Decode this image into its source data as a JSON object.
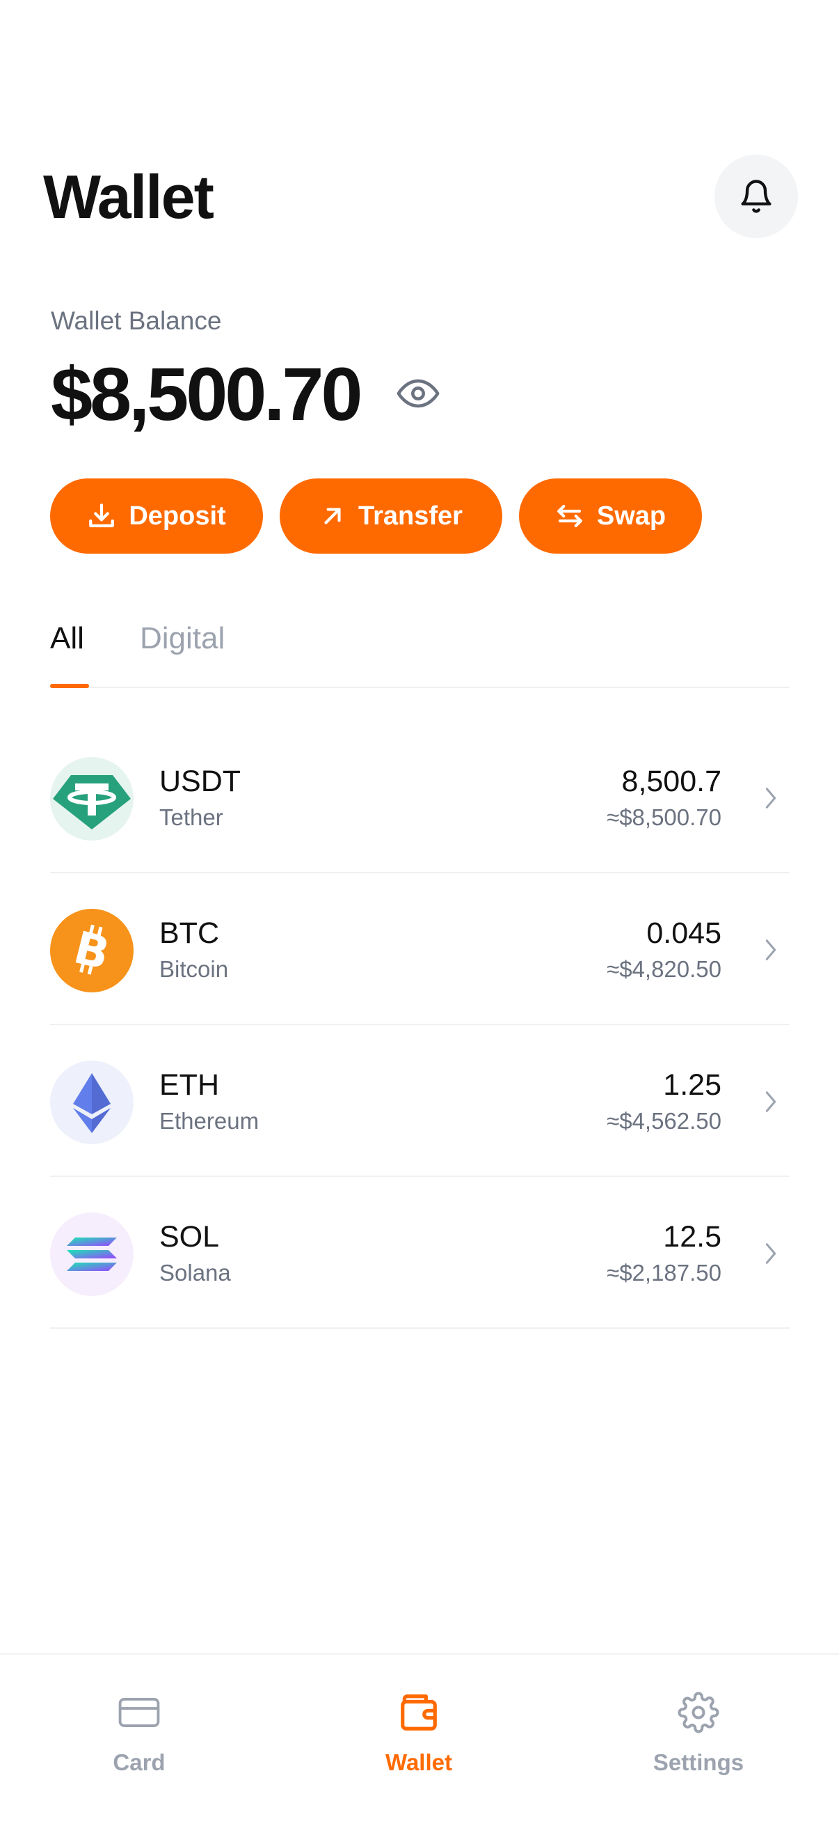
{
  "header": {
    "title": "Wallet",
    "notifications_icon": "bell-icon"
  },
  "balance": {
    "label": "Wallet Balance",
    "amount": "$8,500.70",
    "visibility_icon": "eye-icon"
  },
  "actions": [
    {
      "label": "Deposit",
      "icon": "download-icon"
    },
    {
      "label": "Transfer",
      "icon": "arrow-up-right-icon"
    },
    {
      "label": "Swap",
      "icon": "swap-arrows-icon"
    }
  ],
  "tabs": [
    {
      "label": "All",
      "active": true
    },
    {
      "label": "Digital",
      "active": false
    }
  ],
  "assets": [
    {
      "symbol": "USDT",
      "name": "Tether",
      "amount": "8,500.7",
      "value": "≈$8,500.70",
      "icon": "tether-logo-icon"
    },
    {
      "symbol": "BTC",
      "name": "Bitcoin",
      "amount": "0.045",
      "value": "≈$4,820.50",
      "icon": "bitcoin-logo-icon"
    },
    {
      "symbol": "ETH",
      "name": "Ethereum",
      "amount": "1.25",
      "value": "≈$4,562.50",
      "icon": "ethereum-logo-icon"
    },
    {
      "symbol": "SOL",
      "name": "Solana",
      "amount": "12.5",
      "value": "≈$2,187.50",
      "icon": "solana-logo-icon"
    }
  ],
  "bottom_nav": [
    {
      "label": "Card",
      "icon": "card-icon",
      "active": false
    },
    {
      "label": "Wallet",
      "icon": "wallet-icon",
      "active": true
    },
    {
      "label": "Settings",
      "icon": "gear-icon",
      "active": false
    }
  ],
  "colors": {
    "accent": "#ff6a00",
    "text_primary": "#111111",
    "text_secondary": "#6b7280",
    "text_muted": "#9ca3af",
    "divider": "#eef0f3",
    "tether_green": "#26a17b",
    "bitcoin_orange": "#f7931a",
    "ethereum_purple": "#627eea"
  }
}
